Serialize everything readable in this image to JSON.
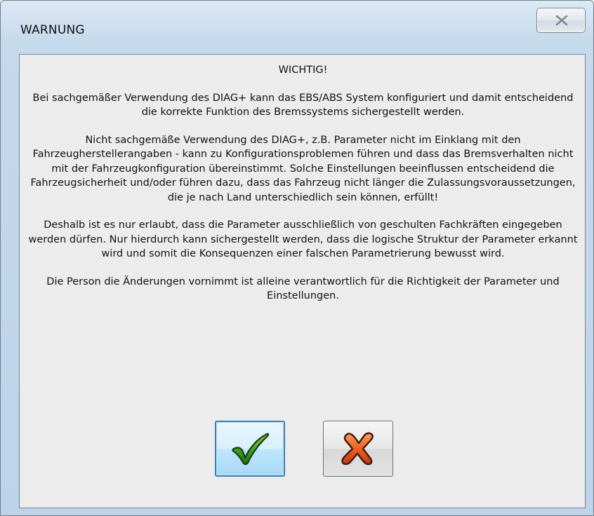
{
  "window": {
    "title": "WARNUNG"
  },
  "message": {
    "heading": "WICHTIG!",
    "paragraph_1": "Bei sachgemäßer Verwendung des DIAG+ kann das EBS/ABS System konfiguriert  und damit entscheidend die korrekte Funktion des Bremssystems sichergestellt werden.",
    "paragraph_2": "Nicht sachgemäße Verwendung des DIAG+, z.B. Parameter nicht im Einklang mit den Fahrzeugherstellerangaben - kann zu Konfigurationsproblemen führen und dass das Bremsverhalten nicht mit der Fahrzeugkonfiguration übereinstimmt. Solche Einstellungen beeinflussen entscheidend die Fahrzeugsicherheit und/oder führen dazu, dass das Fahrzeug nicht länger die Zulassungsvoraussetzungen, die je nach Land unterschiedlich sein können, erfüllt!",
    "paragraph_3": "Deshalb ist es nur erlaubt, dass die Parameter ausschließlich von geschulten Fachkräften eingegeben werden dürfen. Nur hierdurch kann sichergestellt werden, dass die logische Struktur der Parameter erkannt wird und somit die Konsequenzen einer falschen Parametrierung bewusst wird.",
    "paragraph_4": "Die Person die Änderungen vornimmt ist alleine verantwortlich für die Richtigkeit der Parameter und Einstellungen."
  },
  "buttons": {
    "ok_icon": "green-checkmark-icon",
    "cancel_icon": "red-x-icon",
    "close_icon": "close-icon"
  },
  "colors": {
    "check_green": "#2f8a1c",
    "x_red": "#e0501a",
    "focus_border": "#3c7fb1"
  }
}
